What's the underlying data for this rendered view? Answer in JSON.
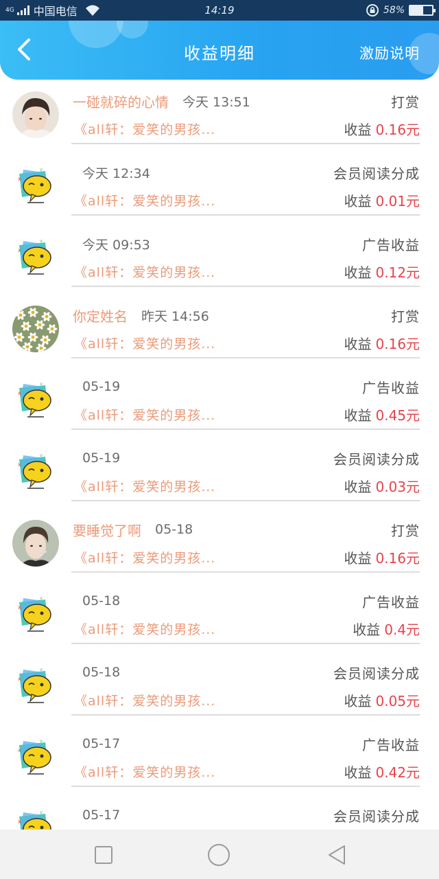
{
  "status_bar": {
    "network": "4G",
    "carrier": "中国电信",
    "time": "14:19",
    "battery_percent": "58%",
    "battery_level": 0.58,
    "icons": [
      "signal-icon",
      "wifi-icon",
      "rotation-lock-icon",
      "battery-icon"
    ]
  },
  "header": {
    "title": "收益明细",
    "help_label": "激励说明",
    "back_icon": "back-arrow-icon"
  },
  "colors": {
    "header_gradient_start": "#3bbdf5",
    "header_gradient_end": "#2a9df0",
    "nickname": "#eb9a78",
    "amount": "#e8434a",
    "type_text": "#555555"
  },
  "list": {
    "items": [
      {
        "avatar": "user-photo",
        "nickname": "一碰就碎的心情",
        "time": "今天 13:51",
        "type": "打赏",
        "book": "《all轩：爱笑的男孩...",
        "earn_label": "收益",
        "amount": "0.16元"
      },
      {
        "avatar": "default",
        "nickname": "",
        "time": "今天 12:34",
        "type": "会员阅读分成",
        "book": "《all轩：爱笑的男孩...",
        "earn_label": "收益",
        "amount": "0.01元"
      },
      {
        "avatar": "default",
        "nickname": "",
        "time": "今天 09:53",
        "type": "广告收益",
        "book": "《all轩：爱笑的男孩...",
        "earn_label": "收益",
        "amount": "0.12元"
      },
      {
        "avatar": "flowers",
        "nickname": "你定姓名",
        "time": "昨天 14:56",
        "type": "打赏",
        "book": "《all轩：爱笑的男孩...",
        "earn_label": "收益",
        "amount": "0.16元"
      },
      {
        "avatar": "default",
        "nickname": "",
        "time": "05-19",
        "type": "广告收益",
        "book": "《all轩：爱笑的男孩...",
        "earn_label": "收益",
        "amount": "0.45元"
      },
      {
        "avatar": "default",
        "nickname": "",
        "time": "05-19",
        "type": "会员阅读分成",
        "book": "《all轩：爱笑的男孩...",
        "earn_label": "收益",
        "amount": "0.03元"
      },
      {
        "avatar": "user-photo-2",
        "nickname": "要睡觉了啊",
        "time": "05-18",
        "type": "打赏",
        "book": "《all轩：爱笑的男孩...",
        "earn_label": "收益",
        "amount": "0.16元"
      },
      {
        "avatar": "default",
        "nickname": "",
        "time": "05-18",
        "type": "广告收益",
        "book": "《all轩：爱笑的男孩...",
        "earn_label": "收益",
        "amount": "0.4元"
      },
      {
        "avatar": "default",
        "nickname": "",
        "time": "05-18",
        "type": "会员阅读分成",
        "book": "《all轩：爱笑的男孩...",
        "earn_label": "收益",
        "amount": "0.05元"
      },
      {
        "avatar": "default",
        "nickname": "",
        "time": "05-17",
        "type": "广告收益",
        "book": "《all轩：爱笑的男孩...",
        "earn_label": "收益",
        "amount": "0.42元"
      },
      {
        "avatar": "default",
        "nickname": "",
        "time": "05-17",
        "type": "会员阅读分成",
        "book": "",
        "earn_label": "",
        "amount": ""
      }
    ]
  },
  "nav_bar": {
    "buttons": [
      "recent-apps-square-icon",
      "home-circle-icon",
      "back-triangle-icon"
    ]
  }
}
